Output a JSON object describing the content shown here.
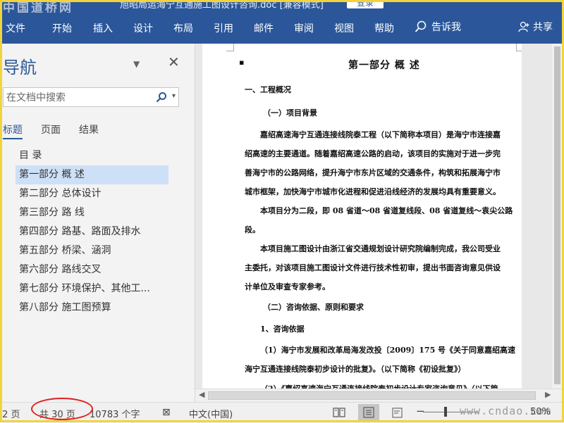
{
  "window": {
    "title": "旭昭局运海宁互通施工图设计咨询.doc [兼容模式]",
    "signin_label": "登录",
    "watermark_top": "中国道桥网"
  },
  "ribbon": {
    "tabs": [
      "文件",
      "开始",
      "插入",
      "设计",
      "布局",
      "引用",
      "邮件",
      "审阅",
      "视图",
      "帮助"
    ],
    "tell_me": "告诉我",
    "share": "共享"
  },
  "nav": {
    "title": "导航",
    "search_placeholder": "在文档中搜索",
    "tabs": [
      "标题",
      "页面",
      "结果"
    ],
    "items": [
      "目  录",
      "第一部分  概   述",
      "第二部分 总体设计",
      "第三部分  路  线",
      "第四部分 路基、路面及排水",
      "第五部分 桥梁、涵洞",
      "第六部分  路线交叉",
      "第七部分 环境保护、其他工...",
      "第八部分 施工图预算"
    ],
    "selected_index": 1
  },
  "document": {
    "heading": "第一部分   概    述",
    "section1": "一、工程概况",
    "sub1": "（一）项目背景",
    "para1": [
      "嘉绍高速海宁互通连接线院泰工程（以下简称本项目）是海宁市连接嘉",
      "绍高速的主要通道。随着嘉绍高速公路的启动，该项目的实施对于进一步完",
      "善海宁市的公路网络，提升海宁市东片区域的交通条件，构筑和拓展海宁市",
      "城市框架，加快海宁市城市化进程和促进沿线经济的发展均具有重要意义。"
    ],
    "para2": [
      "本项目分为二段，即 08 省道～08 省道复线段、08 省道复线～袁尖公路",
      "段。"
    ],
    "para3": [
      "本项目施工图设计由浙江省交通规划设计研究院编制完成，我公司受业",
      "主委托，对该项目施工图设计文件进行技术性初审，提出书面咨询意见供设",
      "计单位及审查专家参考。"
    ],
    "sub2": "（二）咨询依据、原则和要求",
    "sub3": "1、咨询依据",
    "para4": [
      "（1）海宁市发展和改革局海发改投〔2009〕175 号《关于同意嘉绍高速",
      "海宁互通连接线院泰初步设计的批复》。（以下简称《初设批复》）"
    ],
    "para5_partial": "（2）《嘉绍高速海宁互通连接线院泰初步设计专家咨询意见》（以下简"
  },
  "status": {
    "page_info": "第 2 页，共 30 页",
    "page_current": "第 2 页",
    "page_total": "共 30 页",
    "word_count": "10783 个字",
    "language": "中文(中国)",
    "zoom": "50%",
    "watermark": "www.cndao.com"
  }
}
